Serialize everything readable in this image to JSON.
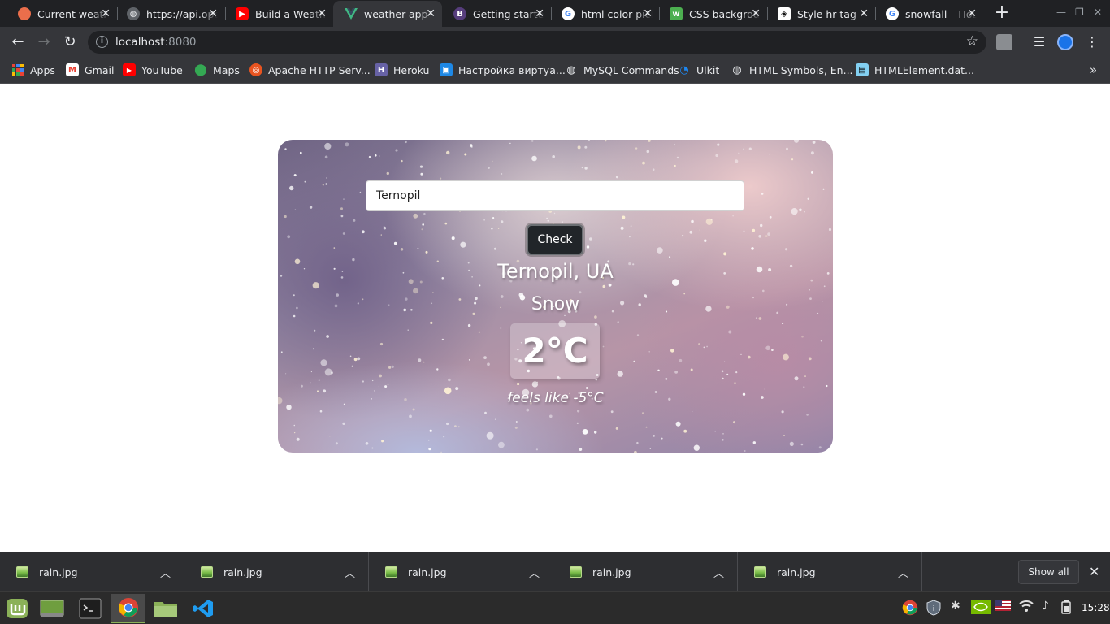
{
  "browser": {
    "tabs": [
      {
        "title": "Current weather",
        "favicon": "openweather-icon",
        "color": "#eb6e4b"
      },
      {
        "title": "https://api.openweathermap.org",
        "favicon": "globe-icon",
        "color": "#9aa0a6"
      },
      {
        "title": "Build a Weather App",
        "favicon": "youtube-icon",
        "color": "#ff0000"
      },
      {
        "title": "weather-app",
        "favicon": "vue-icon",
        "color": "#41b883"
      },
      {
        "title": "Getting started",
        "favicon": "bootstrap-vue-icon",
        "color": "#563d7c"
      },
      {
        "title": "html color picker",
        "favicon": "google-icon",
        "color": "#4285f4"
      },
      {
        "title": "CSS background",
        "favicon": "w3schools-icon",
        "color": "#4caf50"
      },
      {
        "title": "Style hr tag",
        "favicon": "codepen-icon",
        "color": "#ffffff"
      },
      {
        "title": "snowfall – Пошук Google",
        "favicon": "google-icon",
        "color": "#4285f4"
      }
    ],
    "active_tab_index": 3,
    "url_host": "localhost",
    "url_port": ":8080",
    "bookmarks": [
      {
        "label": "Apps",
        "icon": "apps-grid-icon"
      },
      {
        "label": "Gmail",
        "icon": "gmail-icon"
      },
      {
        "label": "YouTube",
        "icon": "youtube-icon"
      },
      {
        "label": "Maps",
        "icon": "maps-pin-icon"
      },
      {
        "label": "Apache HTTP Serv...",
        "icon": "ubuntu-icon"
      },
      {
        "label": "Heroku",
        "icon": "heroku-icon"
      },
      {
        "label": "Настройка виртуа...",
        "icon": "bookmark-page-icon"
      },
      {
        "label": "MySQL Commands",
        "icon": "globe-icon"
      },
      {
        "label": "Ulkit",
        "icon": "uikit-icon"
      },
      {
        "label": "HTML Symbols, En...",
        "icon": "globe-icon"
      },
      {
        "label": "HTMLElement.dat...",
        "icon": "mdn-icon"
      }
    ]
  },
  "weather_app": {
    "search_value": "Ternopil",
    "check_label": "Check",
    "location": "Ternopil, UA",
    "condition": "Snow",
    "temperature": "2°C",
    "feels_like": "feels like -5°C"
  },
  "downloads": {
    "items": [
      "rain.jpg",
      "rain.jpg",
      "rain.jpg",
      "rain.jpg",
      "rain.jpg"
    ],
    "show_all_label": "Show all"
  },
  "taskbar": {
    "clock": "15:28"
  }
}
